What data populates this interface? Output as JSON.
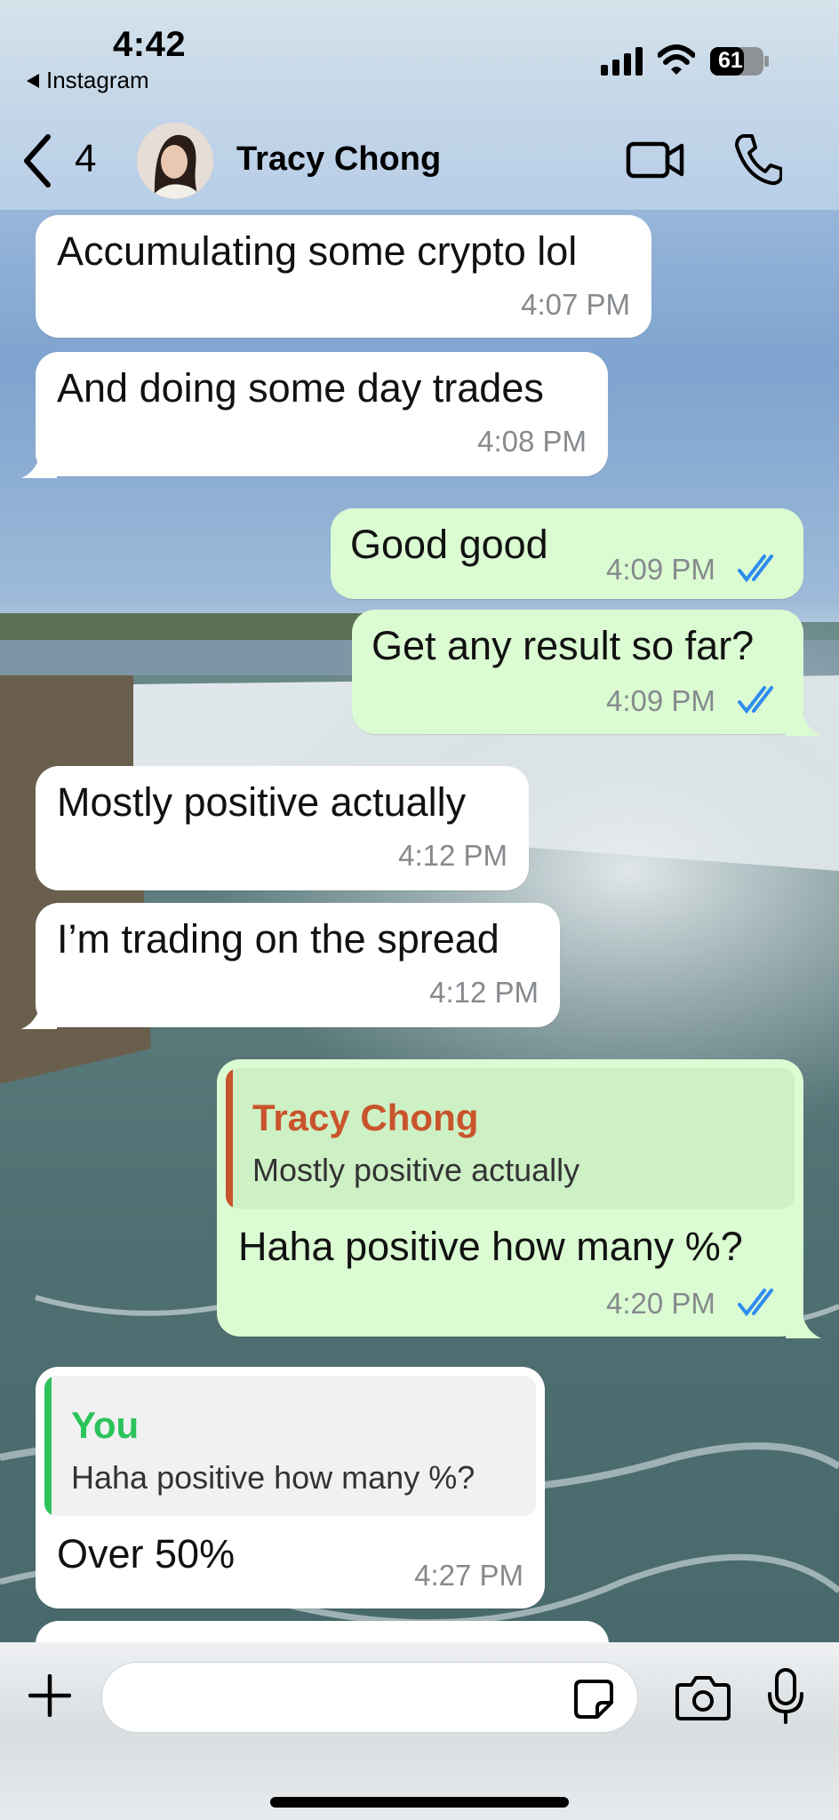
{
  "status_bar": {
    "time": "4:42",
    "back_app": "Instagram",
    "battery": "61"
  },
  "header": {
    "unread_count": "4",
    "contact_name": "Tracy Chong"
  },
  "messages": [
    {
      "direction": "incoming",
      "text": "Accumulating some crypto lol",
      "time": "4:07 PM"
    },
    {
      "direction": "incoming",
      "text": "And doing some day trades",
      "time": "4:08 PM"
    },
    {
      "direction": "outgoing",
      "text": "Good good",
      "time": "4:09 PM",
      "status": "read"
    },
    {
      "direction": "outgoing",
      "text": "Get any result so far?",
      "time": "4:09 PM",
      "status": "read"
    },
    {
      "direction": "incoming",
      "text": "Mostly positive actually",
      "time": "4:12 PM"
    },
    {
      "direction": "incoming",
      "text": "I’m trading on the spread",
      "time": "4:12 PM"
    },
    {
      "direction": "outgoing",
      "text": "Haha positive how many %?",
      "time": "4:20 PM",
      "status": "read",
      "quote": {
        "author": "Tracy Chong",
        "text": "Mostly positive actually"
      }
    },
    {
      "direction": "incoming",
      "text": "Over 50%",
      "time": "4:27 PM",
      "quote": {
        "author": "You",
        "text": "Haha positive how many %?"
      }
    }
  ],
  "composer": {
    "input_value": "",
    "input_placeholder": ""
  },
  "colors": {
    "incoming_bubble": "#ffffff",
    "outgoing_bubble": "#dbfbd2",
    "read_ticks": "#2f8cf0",
    "quote_tracy": "#c9542c",
    "quote_you": "#2bc35a",
    "timestamp": "#868a8e"
  },
  "icons": [
    "back-chevron-icon",
    "video-camera-icon",
    "phone-icon",
    "plus-icon",
    "sticker-icon",
    "camera-icon",
    "microphone-icon",
    "double-check-icon",
    "signal-icon",
    "wifi-icon",
    "battery-icon"
  ]
}
